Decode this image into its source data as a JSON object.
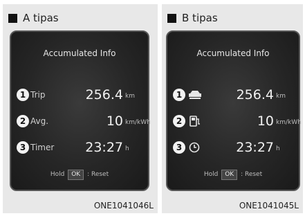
{
  "panel_a": {
    "title": "A tipas",
    "screen_title": "Accumulated Info",
    "rows": [
      {
        "num": "1",
        "label": "Trip",
        "value": "256.4",
        "unit": "km"
      },
      {
        "num": "2",
        "label": "Avg.",
        "value": "10",
        "unit": "km/kWh"
      },
      {
        "num": "3",
        "label": "Timer",
        "value": "23:27",
        "unit": "h"
      }
    ],
    "hint_prefix": "Hold",
    "hint_key": "OK",
    "hint_suffix": ": Reset",
    "code": "ONE1041046L"
  },
  "panel_b": {
    "title": "B tipas",
    "screen_title": "Accumulated Info",
    "rows": [
      {
        "num": "1",
        "icon": "car-icon",
        "value": "256.4",
        "unit": "km"
      },
      {
        "num": "2",
        "icon": "charging-station-icon",
        "value": "10",
        "unit": "km/kWh"
      },
      {
        "num": "3",
        "icon": "clock-icon",
        "value": "23:27",
        "unit": "h"
      }
    ],
    "hint_prefix": "Hold",
    "hint_key": "OK",
    "hint_suffix": ": Reset",
    "code": "ONE1041045L"
  }
}
